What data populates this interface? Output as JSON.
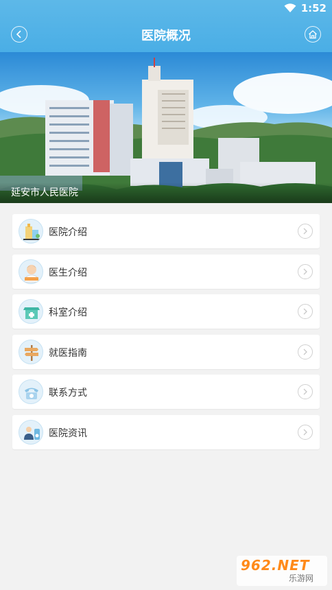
{
  "status_bar": {
    "time": "1:52"
  },
  "header": {
    "title": "医院概况"
  },
  "banner": {
    "caption": "延安市人民医院"
  },
  "menu": {
    "items": [
      {
        "label": "医院介绍",
        "icon": "hospital-building-icon"
      },
      {
        "label": "医生介绍",
        "icon": "doctor-icon"
      },
      {
        "label": "科室介绍",
        "icon": "medical-kit-icon"
      },
      {
        "label": "就医指南",
        "icon": "signpost-icon"
      },
      {
        "label": "联系方式",
        "icon": "telephone-icon"
      },
      {
        "label": "医院资讯",
        "icon": "news-icon"
      }
    ]
  },
  "watermark": {
    "brand": "962.NET",
    "sub": "乐游网"
  },
  "colors": {
    "header_blue": "#4aaee6",
    "background": "#f2f2f2",
    "watermark_orange": "#ff8a1a"
  }
}
